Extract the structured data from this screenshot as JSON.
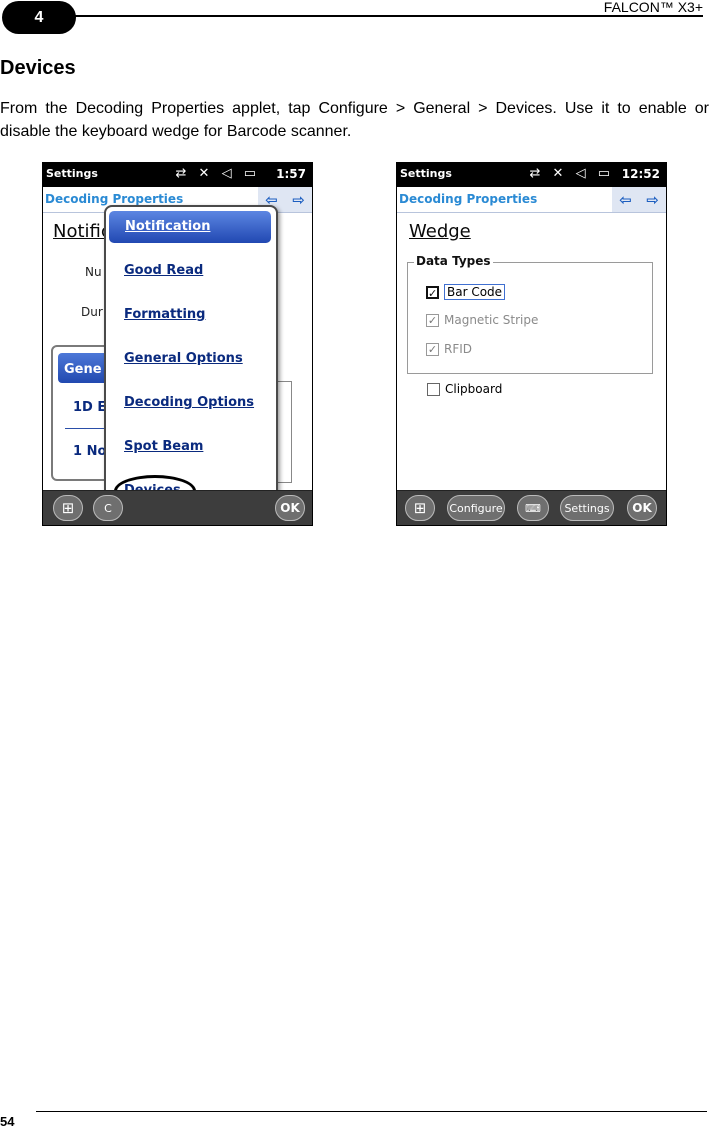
{
  "header": {
    "chapter": "4",
    "product": "FALCON™ X3+"
  },
  "section": {
    "title": "Devices",
    "paragraph": "From the Decoding Properties applet, tap Configure > General > Devices. Use it to enable or disable the keyboard wedge for Barcode scanner."
  },
  "left_screen": {
    "status_title": "Settings",
    "status_icons": "⇄ ✕ ◁ ▭",
    "time": "1:57",
    "app_title": "Decoding Properties",
    "page_heading": "Notific",
    "bg_label_num": "Nu",
    "bg_label_dur": "Dur",
    "bg_menu_selected": "Gene",
    "bg_menu_1d": "1D E",
    "bg_menu_1no": "1 No",
    "menu": [
      "Notification",
      "Good Read",
      "Formatting",
      "General Options",
      "Decoding Options",
      "Spot Beam",
      "Devices"
    ],
    "softkeys": {
      "left": "C",
      "ok": "OK"
    }
  },
  "right_screen": {
    "status_title": "Settings",
    "status_icons": "⇄ ✕ ◁ ▭",
    "time": "12:52",
    "app_title": "Decoding Properties",
    "page_heading": "Wedge",
    "group_title": "Data Types",
    "options": [
      {
        "label": "Bar Code",
        "checked": true
      },
      {
        "label": "Magnetic Stripe",
        "checked": true
      },
      {
        "label": "RFID",
        "checked": true
      }
    ],
    "clipboard": {
      "label": "Clipboard",
      "checked": false
    },
    "softkeys": {
      "configure": "Configure",
      "settings": "Settings",
      "ok": "OK"
    }
  },
  "footer": {
    "page_number": "54"
  }
}
